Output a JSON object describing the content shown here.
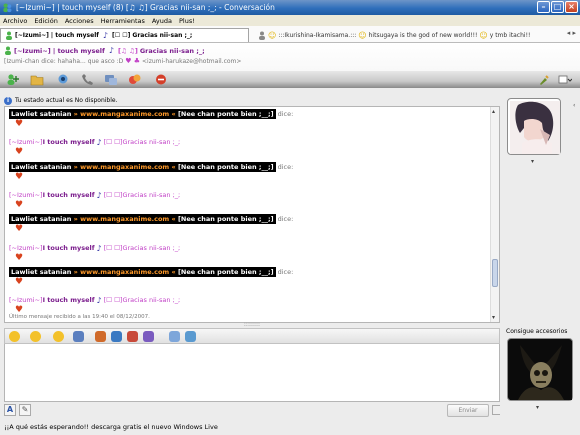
{
  "window": {
    "title": "[~Izumi~] | touch myself (8) [♫ ♫] Gracias nii-san ;_; - Conversación",
    "controls": [
      "–",
      "□",
      "×"
    ]
  },
  "menu": [
    "Archivo",
    "Edición",
    "Acciones",
    "Herramientas",
    "Ayuda",
    "Plus!"
  ],
  "tabs": {
    "active": "[~Izumi~] | touch myself",
    "active_suffix": "[☐ ☐] Gracias nii-san ;_;",
    "inactive": ":::Ikurishina-Ikamisama.:::",
    "inactive_suffix": "hitsugaya is the god of new world!!!",
    "inactive_end": "y tmb itachi!!"
  },
  "contact": {
    "name": "[~Izumi~] | touch myself",
    "note_glyph": "♪",
    "tag": "[♫ ♫]",
    "mood": "Gracias nii-san ;_;",
    "status_msg": "[Izumi-chan dice: hahaha... que asco :D",
    "email": "<izumi-harukaze@hotmail.com>"
  },
  "status_notice": "Tu estado actual es No disponible.",
  "messages": [
    {
      "type": "lawliet",
      "name": "Lawliet satanian",
      "site": "www.mangaxanime.com",
      "extra": "[Nee chan ponte bien ;__;]",
      "verb": "dice:"
    },
    {
      "type": "izumi",
      "tag": "[~Izumi~]",
      "text": "I touch myself",
      "tag2": "[☐ ☐]",
      "text2": "Gracias nii-san ;_;"
    },
    {
      "type": "lawliet",
      "name": "Lawliet satanian",
      "site": "www.mangaxanime.com",
      "extra": "[Nee chan ponte bien ;__;]",
      "verb": "dice:"
    },
    {
      "type": "izumi",
      "tag": "[~Izumi~]",
      "text": "I touch myself",
      "tag2": "[☐ ☐]",
      "text2": "Gracias nii-san ;_;"
    },
    {
      "type": "lawliet",
      "name": "Lawliet satanian",
      "site": "www.mangaxanime.com",
      "extra": "[Nee chan ponte bien ;__;]",
      "verb": "dice:"
    },
    {
      "type": "izumi",
      "tag": "[~Izumi~]",
      "text": "I touch myself",
      "tag2": "[☐ ☐]",
      "text2": "Gracias nii-san ;_;"
    },
    {
      "type": "lawliet",
      "name": "Lawliet satanian",
      "site": "www.mangaxanime.com",
      "extra": "[Nee chan ponte bien ;__;]",
      "verb": "dice:"
    },
    {
      "type": "izumi",
      "tag": "[~Izumi~]",
      "text": "I touch myself",
      "tag2": "[☐ ☐]",
      "text2": "Gracias nii-san ;_;"
    }
  ],
  "last_message": "Último mensaje recibido a las 19:40 el 08/12/2007.",
  "send_label": "Enviar",
  "footer": "¡¡A qué estás esperando!! descarga gratis el nuevo Windows Live",
  "right_panel": {
    "accessories_label": "Consigue accesorios"
  },
  "colors": {
    "title_bar": "#2f6fbb",
    "accent": "#c13fc6"
  }
}
